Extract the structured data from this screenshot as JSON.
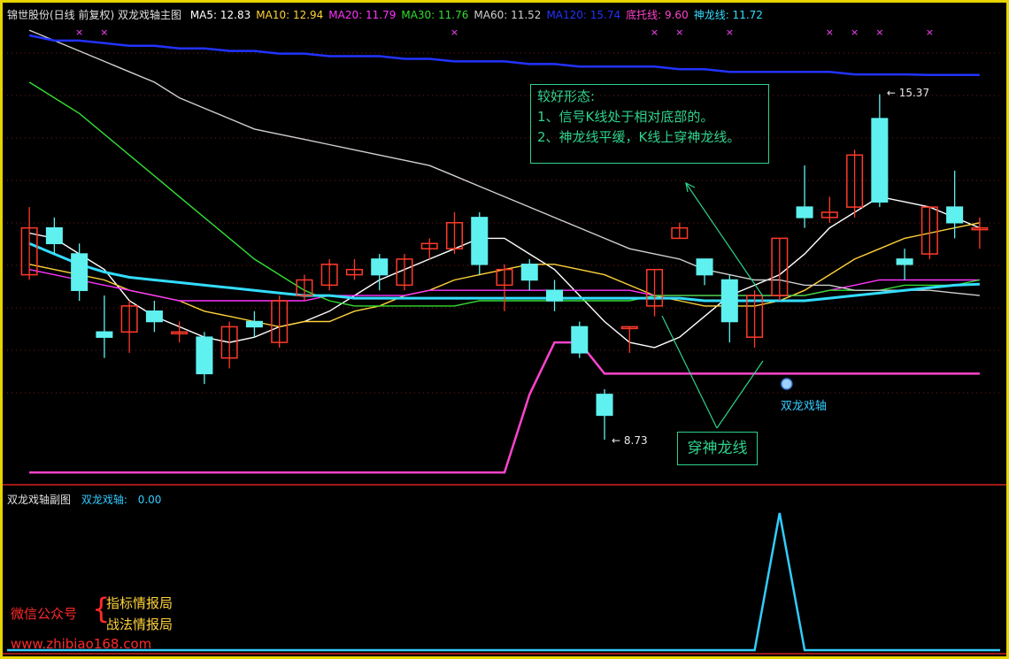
{
  "legend": {
    "title": "锦世股份(日线 前复权) 双龙戏轴主图",
    "items": [
      {
        "label": "MA5:",
        "value": "12.83",
        "color": "#ffffff"
      },
      {
        "label": "MA10:",
        "value": "12.94",
        "color": "#ffd23a"
      },
      {
        "label": "MA20:",
        "value": "11.79",
        "color": "#ff33ff"
      },
      {
        "label": "MA30:",
        "value": "11.76",
        "color": "#33dd33"
      },
      {
        "label": "MA60:",
        "value": "11.52",
        "color": "#cfcfcf"
      },
      {
        "label": "MA120:",
        "value": "15.74",
        "color": "#2233ff"
      },
      {
        "label": "底托线:",
        "value": "9.60",
        "color": "#ff44cc"
      },
      {
        "label": "神龙线:",
        "value": "11.72",
        "color": "#33ddff"
      }
    ]
  },
  "sub_legend": {
    "title": "双龙戏轴副图",
    "indicator": "双龙戏轴:",
    "value": "0.00"
  },
  "annotations": {
    "note_title": "较好形态:",
    "note_line1": "1、信号K线处于相对底部的。",
    "note_line2": "2、神龙线平缓，K线上穿神龙线。",
    "cross_label": "穿神龙线",
    "signal_label": "双龙戏轴",
    "high_label": "15.37",
    "low_label": "8.73"
  },
  "watermark": {
    "wechat": "微信公众号",
    "brand1": "指标情报局",
    "brand2": "战法情报局",
    "site": "www.zhibiao168.com"
  },
  "colors": {
    "up": "#ff3a2a",
    "down": "#5ff0f0",
    "ma5": "#ffffff",
    "ma10": "#ffd23a",
    "ma20": "#ff33ff",
    "ma30": "#33dd33",
    "ma60": "#cfcfcf",
    "ma120": "#2233ff",
    "dituo": "#ff44cc",
    "shenlong": "#33ddff",
    "signal": "#33ccff",
    "border": "#e8d400"
  },
  "chart_data": [
    {
      "type": "candlestick",
      "title": "锦世股份(日线 前复权) 双龙戏轴主图",
      "ylim": [
        8.0,
        16.5
      ],
      "candles": [
        {
          "o": 11.9,
          "h": 13.2,
          "c": 12.8,
          "l": 11.8
        },
        {
          "o": 12.8,
          "h": 13.0,
          "c": 12.5,
          "l": 12.3
        },
        {
          "o": 12.3,
          "h": 12.5,
          "c": 11.6,
          "l": 11.4
        },
        {
          "o": 10.8,
          "h": 11.5,
          "c": 10.7,
          "l": 10.3
        },
        {
          "o": 10.8,
          "h": 11.4,
          "c": 11.3,
          "l": 10.4
        },
        {
          "o": 11.2,
          "h": 11.4,
          "c": 11.0,
          "l": 10.8
        },
        {
          "o": 10.8,
          "h": 11.0,
          "c": 10.8,
          "l": 10.6
        },
        {
          "o": 10.7,
          "h": 10.8,
          "c": 10.0,
          "l": 9.8
        },
        {
          "o": 10.3,
          "h": 11.0,
          "c": 10.9,
          "l": 10.1
        },
        {
          "o": 11.0,
          "h": 11.2,
          "c": 10.9,
          "l": 10.7
        },
        {
          "o": 10.6,
          "h": 11.5,
          "c": 11.4,
          "l": 10.5
        },
        {
          "o": 11.5,
          "h": 11.9,
          "c": 11.8,
          "l": 11.4
        },
        {
          "o": 11.7,
          "h": 12.2,
          "c": 12.1,
          "l": 11.6
        },
        {
          "o": 11.9,
          "h": 12.2,
          "c": 12.0,
          "l": 11.8
        },
        {
          "o": 12.2,
          "h": 12.3,
          "c": 11.9,
          "l": 11.6
        },
        {
          "o": 11.7,
          "h": 12.3,
          "c": 12.2,
          "l": 11.6
        },
        {
          "o": 12.4,
          "h": 12.6,
          "c": 12.5,
          "l": 12.2
        },
        {
          "o": 12.4,
          "h": 13.1,
          "c": 12.9,
          "l": 12.3
        },
        {
          "o": 13.0,
          "h": 13.1,
          "c": 12.1,
          "l": 11.9
        },
        {
          "o": 11.7,
          "h": 12.1,
          "c": 12.0,
          "l": 11.2
        },
        {
          "o": 12.1,
          "h": 12.2,
          "c": 11.8,
          "l": 11.6
        },
        {
          "o": 11.6,
          "h": 11.8,
          "c": 11.4,
          "l": 11.2
        },
        {
          "o": 10.9,
          "h": 11.0,
          "c": 10.4,
          "l": 10.3
        },
        {
          "o": 9.6,
          "h": 9.7,
          "c": 9.2,
          "l": 8.73
        },
        {
          "o": 10.9,
          "h": 10.9,
          "c": 10.9,
          "l": 10.4
        },
        {
          "o": 11.3,
          "h": 12.0,
          "c": 12.0,
          "l": 11.1
        },
        {
          "o": 12.6,
          "h": 12.9,
          "c": 12.8,
          "l": 12.6
        },
        {
          "o": 12.2,
          "h": 12.2,
          "c": 11.9,
          "l": 11.7
        },
        {
          "o": 11.8,
          "h": 11.9,
          "c": 11.0,
          "l": 10.6
        },
        {
          "o": 10.7,
          "h": 11.6,
          "c": 11.5,
          "l": 10.5
        },
        {
          "o": 11.5,
          "h": 12.6,
          "c": 12.6,
          "l": 11.4
        },
        {
          "o": 13.2,
          "h": 14.0,
          "c": 13.0,
          "l": 12.8
        },
        {
          "o": 13.0,
          "h": 13.4,
          "c": 13.1,
          "l": 12.9
        },
        {
          "o": 13.2,
          "h": 14.3,
          "c": 14.2,
          "l": 13.0
        },
        {
          "o": 14.9,
          "h": 15.37,
          "c": 13.3,
          "l": 13.2
        },
        {
          "o": 12.2,
          "h": 12.4,
          "c": 12.1,
          "l": 11.8
        },
        {
          "o": 12.3,
          "h": 13.2,
          "c": 13.2,
          "l": 12.2
        },
        {
          "o": 13.2,
          "h": 13.9,
          "c": 12.9,
          "l": 12.6
        },
        {
          "o": 12.8,
          "h": 13.0,
          "c": 12.8,
          "l": 12.4
        }
      ],
      "series": [
        {
          "name": "MA5",
          "values": [
            12.7,
            12.6,
            12.3,
            12.0,
            11.4,
            11.1,
            10.9,
            10.7,
            10.6,
            10.7,
            10.9,
            11.0,
            11.2,
            11.5,
            11.8,
            12.0,
            12.2,
            12.4,
            12.6,
            12.6,
            12.3,
            12.0,
            11.5,
            11.0,
            10.6,
            10.5,
            10.7,
            11.1,
            11.5,
            11.7,
            11.9,
            12.3,
            12.8,
            13.1,
            13.4,
            13.3,
            13.2,
            13.0,
            12.8
          ]
        },
        {
          "name": "MA10",
          "values": [
            12.1,
            12.0,
            11.9,
            11.8,
            11.6,
            11.5,
            11.4,
            11.2,
            11.1,
            11.0,
            10.9,
            11.0,
            11.0,
            11.2,
            11.3,
            11.5,
            11.6,
            11.8,
            11.9,
            12.0,
            12.1,
            12.1,
            12.0,
            11.9,
            11.7,
            11.5,
            11.4,
            11.3,
            11.3,
            11.3,
            11.4,
            11.6,
            11.9,
            12.2,
            12.4,
            12.6,
            12.7,
            12.8,
            12.9
          ]
        },
        {
          "name": "MA20",
          "values": [
            12.0,
            11.9,
            11.8,
            11.7,
            11.6,
            11.5,
            11.4,
            11.4,
            11.4,
            11.4,
            11.4,
            11.4,
            11.5,
            11.5,
            11.5,
            11.5,
            11.6,
            11.6,
            11.6,
            11.6,
            11.6,
            11.6,
            11.6,
            11.6,
            11.6,
            11.5,
            11.5,
            11.5,
            11.5,
            11.5,
            11.5,
            11.5,
            11.6,
            11.7,
            11.8,
            11.8,
            11.8,
            11.8,
            11.8
          ]
        },
        {
          "name": "MA30",
          "values": [
            15.6,
            15.3,
            15.0,
            14.6,
            14.2,
            13.8,
            13.4,
            13.0,
            12.6,
            12.2,
            11.9,
            11.6,
            11.4,
            11.3,
            11.3,
            11.3,
            11.3,
            11.3,
            11.4,
            11.4,
            11.4,
            11.4,
            11.4,
            11.4,
            11.4,
            11.5,
            11.5,
            11.5,
            11.5,
            11.5,
            11.5,
            11.5,
            11.6,
            11.6,
            11.6,
            11.7,
            11.7,
            11.7,
            11.8
          ]
        },
        {
          "name": "MA60",
          "values": [
            16.6,
            16.4,
            16.2,
            16.0,
            15.8,
            15.6,
            15.3,
            15.1,
            14.9,
            14.7,
            14.6,
            14.5,
            14.4,
            14.3,
            14.2,
            14.1,
            14.0,
            13.8,
            13.6,
            13.4,
            13.2,
            13.0,
            12.8,
            12.6,
            12.4,
            12.3,
            12.2,
            12.0,
            11.9,
            11.8,
            11.8,
            11.7,
            11.7,
            11.6,
            11.6,
            11.6,
            11.6,
            11.55,
            11.5
          ]
        },
        {
          "name": "MA120",
          "values": [
            16.5,
            16.4,
            16.4,
            16.35,
            16.3,
            16.3,
            16.25,
            16.25,
            16.2,
            16.2,
            16.15,
            16.15,
            16.1,
            16.1,
            16.1,
            16.05,
            16.05,
            16.0,
            16.0,
            16.0,
            15.95,
            15.95,
            15.9,
            15.9,
            15.9,
            15.9,
            15.85,
            15.85,
            15.8,
            15.8,
            15.8,
            15.8,
            15.8,
            15.75,
            15.75,
            15.75,
            15.74,
            15.74,
            15.74
          ]
        },
        {
          "name": "神龙线",
          "values": [
            12.5,
            12.3,
            12.1,
            11.95,
            11.85,
            11.8,
            11.75,
            11.7,
            11.65,
            11.6,
            11.55,
            11.5,
            11.5,
            11.45,
            11.45,
            11.45,
            11.45,
            11.45,
            11.45,
            11.45,
            11.45,
            11.45,
            11.45,
            11.45,
            11.45,
            11.45,
            11.45,
            11.4,
            11.4,
            11.4,
            11.4,
            11.4,
            11.45,
            11.5,
            11.55,
            11.6,
            11.65,
            11.7,
            11.72
          ]
        },
        {
          "name": "底托线",
          "values": [
            8.1,
            8.1,
            8.1,
            8.1,
            8.1,
            8.1,
            8.1,
            8.1,
            8.1,
            8.1,
            8.1,
            8.1,
            8.1,
            8.1,
            8.1,
            8.1,
            8.1,
            8.1,
            8.1,
            8.1,
            9.6,
            10.6,
            10.6,
            10.0,
            10.0,
            10.0,
            10.0,
            10.0,
            10.0,
            10.0,
            10.0,
            10.0,
            10.0,
            10.0,
            10.0,
            10.0,
            10.0,
            10.0,
            10.0
          ]
        }
      ],
      "markers": {
        "signal_index": 30,
        "high_index": 34,
        "low_index": 23
      }
    },
    {
      "type": "line",
      "title": "双龙戏轴副图",
      "ylim": [
        0,
        1
      ],
      "series": [
        {
          "name": "双龙戏轴",
          "values": [
            0,
            0,
            0,
            0,
            0,
            0,
            0,
            0,
            0,
            0,
            0,
            0,
            0,
            0,
            0,
            0,
            0,
            0,
            0,
            0,
            0,
            0,
            0,
            0,
            0,
            0,
            0,
            0,
            0,
            0,
            1,
            0,
            0,
            0,
            0,
            0,
            0,
            0,
            0
          ]
        }
      ]
    }
  ]
}
